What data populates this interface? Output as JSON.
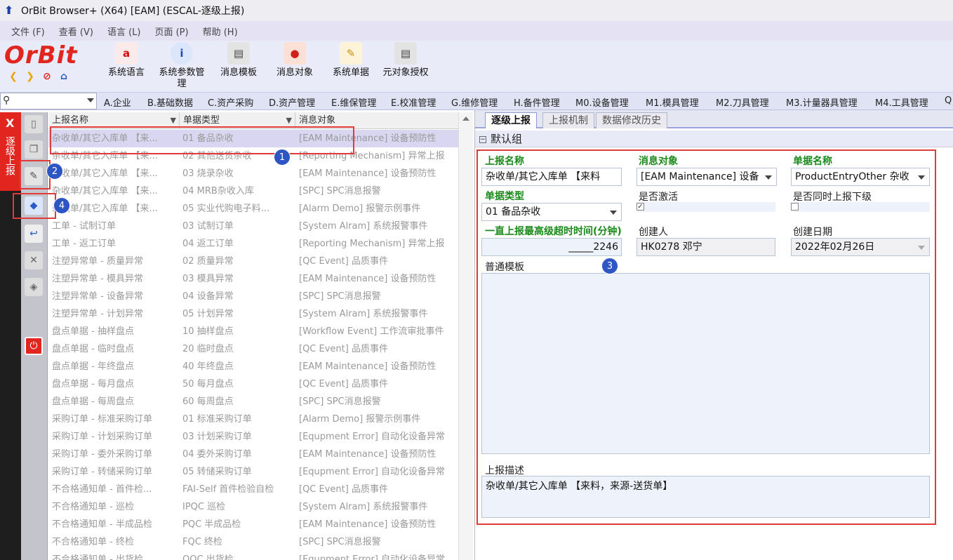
{
  "window": {
    "title": "OrBit Browser+ (X64) [EAM] (ESCAL-逐级上报)"
  },
  "menu": [
    "文件 (F)",
    "查看 (V)",
    "语言 (L)",
    "页面 (P)",
    "帮助 (H)"
  ],
  "brand": "OrBit",
  "toolbar": [
    {
      "label": "系统语言",
      "icon": "language-icon"
    },
    {
      "label": "系统参数管理",
      "icon": "system-param-icon"
    },
    {
      "label": "消息模板",
      "icon": "message-template-icon"
    },
    {
      "label": "消息对象",
      "icon": "message-object-icon"
    },
    {
      "label": "系统单据",
      "icon": "system-document-icon"
    },
    {
      "label": "元对象授权",
      "icon": "meta-object-auth-icon"
    }
  ],
  "modules": [
    "A.企业",
    "B.基础数据",
    "C.资产采购",
    "D.资产管理",
    "E.维保管理",
    "E.校准管理",
    "G.维修管理",
    "H.备件管理",
    "M0.设备管理",
    "M1.模具管理",
    "M2.刀具管理",
    "M3.计量器具管理",
    "M4.工具管理",
    "Q"
  ],
  "side_tab": {
    "close": "X",
    "label": "逐级上报"
  },
  "grid": {
    "columns": [
      "上报名称",
      "单据类型",
      "消息对象"
    ],
    "rows": [
      [
        "杂收单/其它入库单 【来...",
        "01 备品杂收",
        "[EAM Maintenance] 设备预防性"
      ],
      [
        "杂收单/其它入库单 【来...",
        "02 其他送货杂收",
        "[Reporting Mechanism] 异常上报"
      ],
      [
        "杂收单/其它入库单 【来...",
        "03 烧录杂收",
        "[EAM Maintenance] 设备预防性"
      ],
      [
        "杂收单/其它入库单 【来...",
        "04 MRB杂收入库",
        "[SPC] SPC消息报警"
      ],
      [
        "杂收单/其它入库单 【来...",
        "05 实业代购电子料...",
        "[Alarm Demo] 报警示例事件"
      ],
      [
        "工单 - 试制订单",
        "03 试制订单",
        "[System Alram] 系统报警事件"
      ],
      [
        "工单 - 返工订单",
        "04 返工订单",
        "[Reporting Mechanism] 异常上报"
      ],
      [
        "注塑异常单 - 质量异常",
        "02 质量异常",
        "[QC Event] 品质事件"
      ],
      [
        "注塑异常单 - 模具异常",
        "03 模具异常",
        "[EAM Maintenance] 设备预防性"
      ],
      [
        "注塑异常单 - 设备异常",
        "04 设备异常",
        "[SPC] SPC消息报警"
      ],
      [
        "注塑异常单 - 计划异常",
        "05 计划异常",
        "[System Alram] 系统报警事件"
      ],
      [
        "盘点单据 - 抽样盘点",
        "10 抽样盘点",
        "[Workflow Event] 工作流审批事件"
      ],
      [
        "盘点单据 - 临时盘点",
        "20 临时盘点",
        "[QC Event] 品质事件"
      ],
      [
        "盘点单据 - 年终盘点",
        "40 年终盘点",
        "[EAM Maintenance] 设备预防性"
      ],
      [
        "盘点单据 - 每月盘点",
        "50 每月盘点",
        "[QC Event] 品质事件"
      ],
      [
        "盘点单据 - 每周盘点",
        "60 每周盘点",
        "[SPC] SPC消息报警"
      ],
      [
        "采购订单 - 标准采购订单",
        "01 标准采购订单",
        "[Alarm Demo] 报警示例事件"
      ],
      [
        "采购订单 - 计划采购订单",
        "03 计划采购订单",
        "[Equpment Error] 自动化设备异常"
      ],
      [
        "采购订单 - 委外采购订单",
        "04 委外采购订单",
        "[EAM Maintenance] 设备预防性"
      ],
      [
        "采购订单 - 转储采购订单",
        "05 转储采购订单",
        "[Equpment Error] 自动化设备异常"
      ],
      [
        "不合格通知单 - 首件检...",
        "FAI-Self 首件检验自检",
        "[QC Event] 品质事件"
      ],
      [
        "不合格通知单 - 巡检",
        "IPQC 巡检",
        "[System Alram] 系统报警事件"
      ],
      [
        "不合格通知单 - 半成品检",
        "PQC 半成品检",
        "[EAM Maintenance] 设备预防性"
      ],
      [
        "不合格通知单 - 终检",
        "FQC 终检",
        "[SPC] SPC消息报警"
      ],
      [
        "不合格通知单 - 出货检",
        "OQC 出货检",
        "[Equpment Error] 自动化设备异常"
      ]
    ]
  },
  "tabs": [
    "逐级上报",
    "上报机制",
    "数据修改历史"
  ],
  "group": "默认组",
  "form": {
    "report_name_label": "上报名称",
    "report_name": "杂收单/其它入库单 【来料",
    "msg_object_label": "消息对象",
    "msg_object": "[EAM Maintenance] 设备",
    "doc_name_label": "单据名称",
    "doc_name": "ProductEntryOther 杂收",
    "doc_type_label": "单据类型",
    "doc_type": "01 备品杂收",
    "active_label": "是否激活",
    "active_check": "✓",
    "sub_report_label": "是否同时上报下级",
    "timeout_label": "一直上报最高级超时时间(分钟)",
    "timeout": "_____2246",
    "creator_label": "创建人",
    "creator": "HK0278 邓宁",
    "created_date_label": "创建日期",
    "created_date": "2022年02月26日",
    "template_label": "普通模板",
    "desc_label": "上报描述",
    "desc": "杂收单/其它入库单 【来料，来源-送货单】"
  },
  "badges": [
    "1",
    "2",
    "3",
    "4"
  ],
  "colors": {
    "accent_red": "#e03a3a",
    "badge_blue": "#2d56c4",
    "required_green": "#1a8a1a"
  }
}
